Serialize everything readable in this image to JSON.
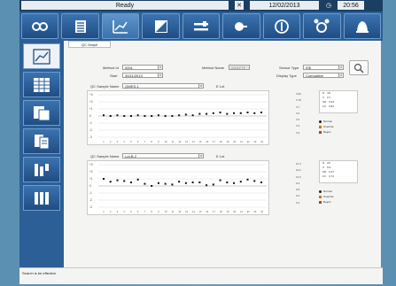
{
  "status": {
    "text": "Ready",
    "close_glyph": "✕",
    "date": "12/02/2013",
    "time": "20:56"
  },
  "toolbar": {
    "buttons": [
      {
        "name": "settings-icon"
      },
      {
        "name": "list-icon"
      },
      {
        "name": "chart-icon",
        "active": true
      },
      {
        "name": "graph-icon"
      },
      {
        "name": "sliders-icon"
      },
      {
        "name": "link-icon"
      },
      {
        "name": "power-icon"
      },
      {
        "name": "alarm-icon"
      },
      {
        "name": "bell-icon"
      }
    ]
  },
  "sidebar": {
    "items": [
      {
        "name": "qc-graph-icon",
        "active": true
      },
      {
        "name": "table-icon"
      },
      {
        "name": "report-icon"
      },
      {
        "name": "document-icon"
      },
      {
        "name": "flow-icon"
      },
      {
        "name": "bars-icon"
      }
    ]
  },
  "form": {
    "tab": "QC Graph",
    "method_label": "Method Id",
    "method_value": "0001",
    "method_name_label": "Method Name",
    "method_name_value": "0001FTF",
    "sensor_type_label": "Sensor Type",
    "sensor_type_value": "ISE",
    "start_label": "Start",
    "start_value": "30/11/2013",
    "display_type_label": "Display Type",
    "display_type_value": "Cumulative"
  },
  "charts": [
    {
      "sample_label": "QC Sample Name",
      "sample_value": "QWES-1",
      "unit": "E Lot",
      "yticks": [
        "+3",
        "+2",
        "+1",
        "0",
        "-1",
        "-2",
        "-3"
      ],
      "rticks": [
        "3.90",
        "3.78",
        "3.7",
        "3.6",
        "3.5",
        "3.4",
        "3.3"
      ],
      "stats": [
        [
          "N",
          "18"
        ],
        [
          "X",
          "3.7"
        ],
        [
          "SD",
          "0.03"
        ],
        [
          "CV",
          "0.81"
        ]
      ],
      "legend": [
        "Normal",
        "Override",
        "Reject"
      ],
      "points": [
        0.1,
        0.0,
        0.1,
        0.0,
        0.0,
        0.1,
        0.0,
        0.0,
        0.1,
        0.0,
        0.0,
        0.1,
        0.2,
        0.1,
        0.3,
        0.3,
        0.4,
        0.5,
        0.3,
        0.4,
        0.4,
        0.5,
        0.4,
        0.5
      ]
    },
    {
      "sample_label": "QC Sample Name",
      "sample_value": "Lot-B-2",
      "unit": "E Lot",
      "yticks": [
        "+3",
        "+2",
        "+1",
        "0",
        "-1",
        "-2",
        "-3"
      ],
      "rticks": [
        "10.4",
        "10.2",
        "10.0",
        "9.9",
        "9.8",
        "9.6",
        "9.4"
      ],
      "stats": [
        [
          "N",
          "20"
        ],
        [
          "X",
          "9.9"
        ],
        [
          "SD",
          "0.07"
        ],
        [
          "CV",
          "0.72"
        ]
      ],
      "legend": [
        "Normal",
        "Override",
        "Reject"
      ],
      "points": [
        1.0,
        0.6,
        0.8,
        0.7,
        0.5,
        0.9,
        0.3,
        0.0,
        0.4,
        0.3,
        0.2,
        0.6,
        0.4,
        0.5,
        0.5,
        0.1,
        0.2,
        0.8,
        0.5,
        0.4,
        0.6,
        0.9,
        0.7,
        0.5
      ]
    }
  ],
  "statusbar": {
    "text": "Search is be effective"
  }
}
